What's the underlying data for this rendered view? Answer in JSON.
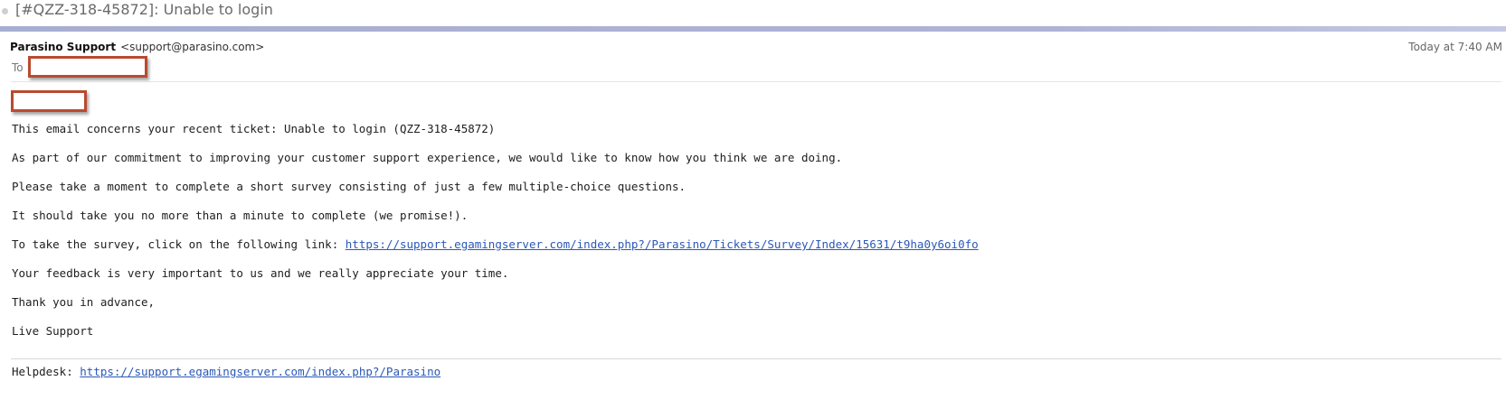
{
  "message": {
    "subject": "[#QZZ-318-45872]: Unable to login",
    "from_name": "Parasino Support",
    "from_email": "<support@parasino.com>",
    "timestamp": "Today at 7:40 AM",
    "to_label": "To"
  },
  "body": {
    "line1": "This email concerns your recent ticket: Unable to login (QZZ-318-45872)",
    "line2": "As part of our commitment to improving your customer support experience, we would like to know how you think we are doing.",
    "line3": "Please take a moment to complete a short survey consisting of just a few multiple-choice questions.",
    "line4": "It should take you no more than a minute to complete (we promise!).",
    "line5_prefix": "To take the survey, click on the following link:",
    "survey_link": "https://support.egamingserver.com/index.php?/Parasino/Tickets/Survey/Index/15631/t9ha0y6oi0fo",
    "line6": "Your feedback is very important to us and we really appreciate your time.",
    "line7": "Thank you in advance,",
    "signature": "Live Support"
  },
  "footer": {
    "helpdesk_label": "Helpdesk:",
    "helpdesk_link": "https://support.egamingserver.com/index.php?/Parasino"
  },
  "colors": {
    "link": "#2a58b7",
    "redaction_border": "#b94a30",
    "header_rule": "#a7aed2"
  }
}
